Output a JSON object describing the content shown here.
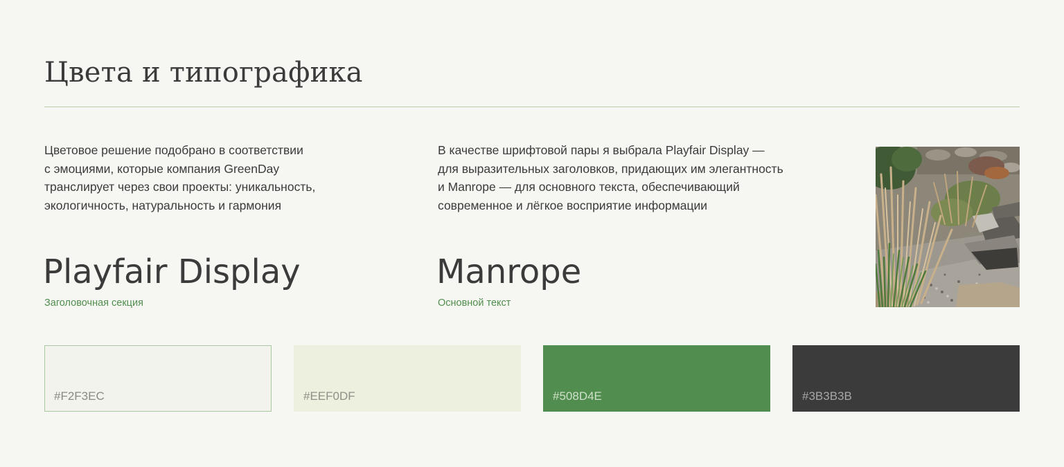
{
  "section": {
    "title": "Цвета и типографика"
  },
  "colors_text": {
    "lines": [
      "Цветовое решение подобрано в соответствии",
      "с эмоциями, которые компания GreenDay",
      "транслирует через свои проекты: уникальность,",
      "экологичность, натуральность и гармония"
    ]
  },
  "fonts_text": {
    "lines": [
      "В качестве шрифтовой пары я выбрала  Playfair Display —",
      "для выразительных заголовков, придающих им элегантность",
      "и Manrope — для основного текста, обеспечивающий",
      "современное и лёгкое восприятие информации"
    ]
  },
  "fonts": {
    "heading": {
      "name": "Playfair Display",
      "caption": "Заголовочная секция"
    },
    "body": {
      "name": "Manrope",
      "caption": "Основной текст"
    }
  },
  "palette": [
    {
      "hex": "#F2F3EC",
      "bg": "#F2F3EC",
      "label_color": "#8A8A84"
    },
    {
      "hex": "#EEF0DF",
      "bg": "#EEF0DF",
      "label_color": "#8E8F86"
    },
    {
      "hex": "#508D4E",
      "bg": "#508D4E",
      "label_color": "#CFE0C8"
    },
    {
      "hex": "#3B3B3B",
      "bg": "#3B3B3B",
      "label_color": "#A7A7A7"
    }
  ],
  "colors": {
    "page_bg": "#F6F7F2",
    "text": "#3B3B3B",
    "accent": "#508D4E",
    "divider": "#B9CCAE"
  },
  "image": {
    "icon": "garden-photo-icon"
  }
}
